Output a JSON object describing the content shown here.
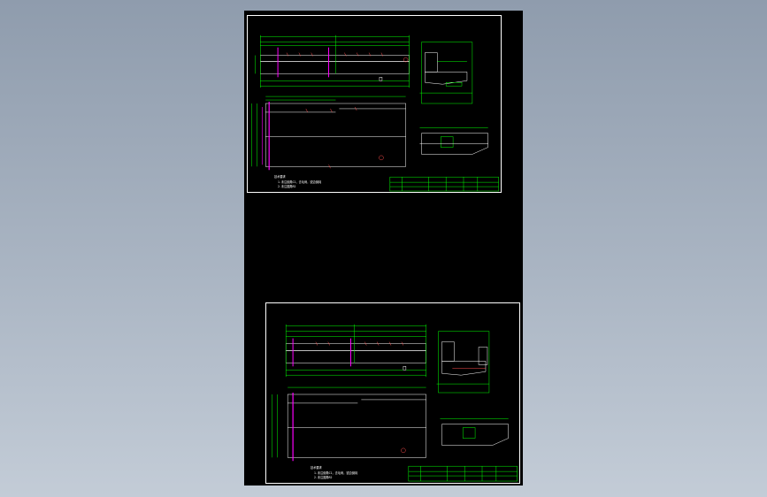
{
  "viewer": {
    "background_top": "#8f9cad",
    "background_bottom": "#c3ccd7",
    "canvas_color": "#000000"
  },
  "colors": {
    "outline": "#ffffff",
    "dimension": "#00ff00",
    "centerline": "#ff00ff",
    "hatch": "#ff4d4d",
    "hidden": "#ffff00"
  },
  "sheets": [
    {
      "name": "drawing-sheet-top",
      "notes": [
        "技术要求",
        "1.未注倒角C1，去毛刺，锐边倒钝",
        "2.未注圆角R2"
      ],
      "title_block": {
        "cells": [
          "",
          "",
          "",
          "",
          "",
          "",
          "",
          ""
        ]
      }
    },
    {
      "name": "drawing-sheet-bottom",
      "notes": [
        "技术要求",
        "1.未注倒角C1，去毛刺，锐边倒钝",
        "2.未注圆角R2"
      ],
      "title_block": {
        "cells": [
          "",
          "",
          "",
          "",
          "",
          "",
          "",
          ""
        ]
      }
    }
  ]
}
